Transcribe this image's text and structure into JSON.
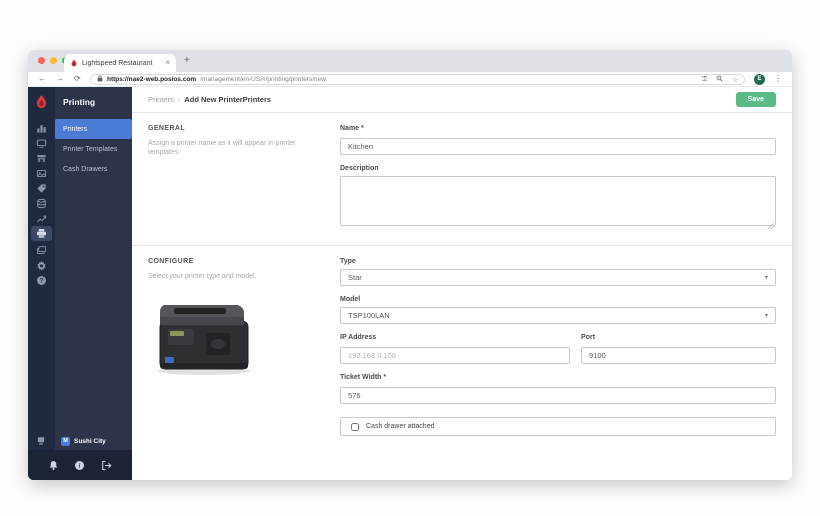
{
  "browser": {
    "tab_title": "Lightspeed Restaurant",
    "tab_close_glyph": "×",
    "new_tab_glyph": "+",
    "back_glyph": "←",
    "forward_glyph": "→",
    "reload_glyph": "⟳",
    "lock_glyph": "🔒",
    "url_host": "https://nae2-web.posios.com",
    "url_path": "/management/en-US/#/printing/printers/new",
    "key_glyph": "⚿",
    "zoom_glyph": "🔍",
    "star_glyph": "☆",
    "avatar_letter": "E",
    "menu_glyph": "⋮"
  },
  "sidebar": {
    "title": "Printing",
    "items": [
      {
        "label": "Printers",
        "selected": true
      },
      {
        "label": "Printer Templates",
        "selected": false
      },
      {
        "label": "Cash Drawers",
        "selected": false
      }
    ],
    "location": {
      "badge": "M",
      "name": "Sushi City"
    }
  },
  "header": {
    "breadcrumb_parent": "Printers",
    "breadcrumb_separator": "›",
    "breadcrumb_current": "Add New PrinterPrinters",
    "save_label": "Save"
  },
  "general": {
    "section_title": "GENERAL",
    "section_description": "Assign a printer name as it will appear in printer templates.",
    "name_label": "Name *",
    "name_value": "Kitchen",
    "description_label": "Description",
    "description_value": ""
  },
  "configure": {
    "section_title": "CONFIGURE",
    "section_description": "Select your printer type and model.",
    "type_label": "Type",
    "type_value": "Star",
    "model_label": "Model",
    "model_value": "TSP100LAN",
    "ip_label": "IP Address",
    "ip_placeholder": "192.168.0.108",
    "port_label": "Port",
    "port_value": "9100",
    "ticket_width_label": "Ticket Width *",
    "ticket_width_value": "576",
    "cash_drawer_label": "Cash drawer attached",
    "select_caret_glyph": "▾"
  },
  "colors": {
    "brand_red": "#d63a3f",
    "accent_blue": "#4b7bd5",
    "save_green": "#5cba87",
    "sidebar_rail": "#1f2940",
    "sidebar_panel": "#2b3449",
    "traffic_red": "#ff5f57",
    "traffic_yellow": "#febc2e",
    "traffic_green": "#28c840"
  }
}
